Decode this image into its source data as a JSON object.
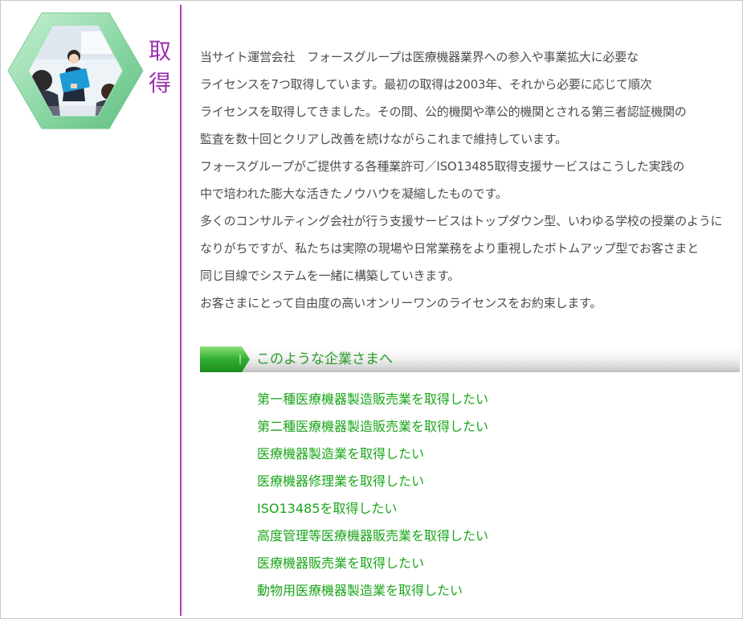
{
  "heading": {
    "chars": [
      "取",
      "得"
    ]
  },
  "body": {
    "paragraphs": [
      "当サイト運営会社　フォースグループは医療機器業界への参入や事業拡大に必要な",
      "ライセンスを7つ取得しています。最初の取得は2003年、それから必要に応じて順次",
      "ライセンスを取得してきました。その間、公的機関や準公的機関とされる第三者認証機関の",
      "監査を数十回とクリアし改善を続けながらこれまで維持しています。",
      "フォースグループがご提供する各種業許可／ISO13485取得支援サービスはこうした実践の",
      "中で培われた膨大な活きたノウハウを凝縮したものです。",
      "多くのコンサルティング会社が行う支援サービスはトップダウン型、いわゆる学校の授業のように",
      "なりがちですが、私たちは実際の現場や日常業務をより重視したボトムアップ型でお客さまと",
      "同じ目線でシステムを一緒に構築していきます。",
      "お客さまにとって自由度の高いオンリーワンのライセンスをお約束します。"
    ]
  },
  "section": {
    "title": "このような企業さまへ"
  },
  "links": [
    "第一種医療機器製造販売業を取得したい",
    "第二種医療機器製造販売業を取得したい",
    "医療機器製造業を取得したい",
    "医療機器修理業を取得したい",
    "ISO13485を取得したい",
    "高度管理等医療機器販売業を取得したい",
    "医療機器販売業を取得したい",
    "動物用医療機器製造業を取得したい"
  ],
  "colors": {
    "accent_purple": "#9b2fae",
    "link_green": "#1aa51a",
    "hex_green": "#8fd9a8"
  }
}
